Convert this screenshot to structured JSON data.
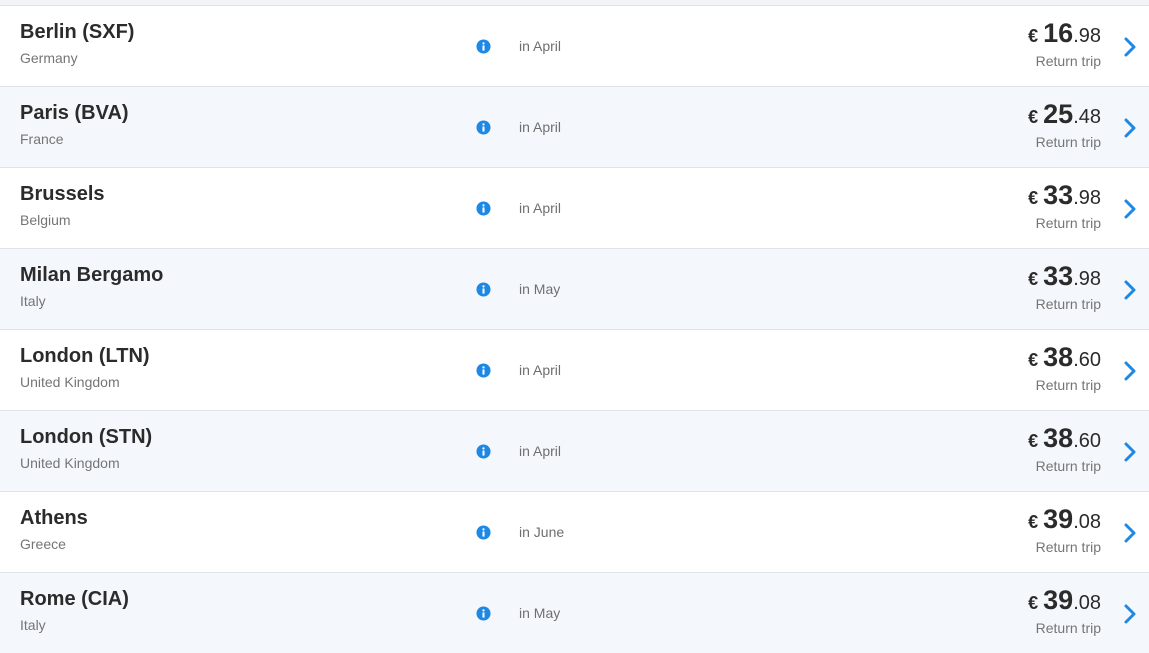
{
  "currency_symbol": "€",
  "icon_color": "#1e88e5",
  "flights": [
    {
      "city": "Berlin (SXF)",
      "country": "Germany",
      "month": "in April",
      "price_int": "16",
      "price_dec": ".98",
      "trip": "Return trip"
    },
    {
      "city": "Paris (BVA)",
      "country": "France",
      "month": "in April",
      "price_int": "25",
      "price_dec": ".48",
      "trip": "Return trip"
    },
    {
      "city": "Brussels",
      "country": "Belgium",
      "month": "in April",
      "price_int": "33",
      "price_dec": ".98",
      "trip": "Return trip"
    },
    {
      "city": "Milan Bergamo",
      "country": "Italy",
      "month": "in May",
      "price_int": "33",
      "price_dec": ".98",
      "trip": "Return trip"
    },
    {
      "city": "London (LTN)",
      "country": "United Kingdom",
      "month": "in April",
      "price_int": "38",
      "price_dec": ".60",
      "trip": "Return trip"
    },
    {
      "city": "London (STN)",
      "country": "United Kingdom",
      "month": "in April",
      "price_int": "38",
      "price_dec": ".60",
      "trip": "Return trip"
    },
    {
      "city": "Athens",
      "country": "Greece",
      "month": "in June",
      "price_int": "39",
      "price_dec": ".08",
      "trip": "Return trip"
    },
    {
      "city": "Rome (CIA)",
      "country": "Italy",
      "month": "in May",
      "price_int": "39",
      "price_dec": ".08",
      "trip": "Return trip"
    }
  ]
}
